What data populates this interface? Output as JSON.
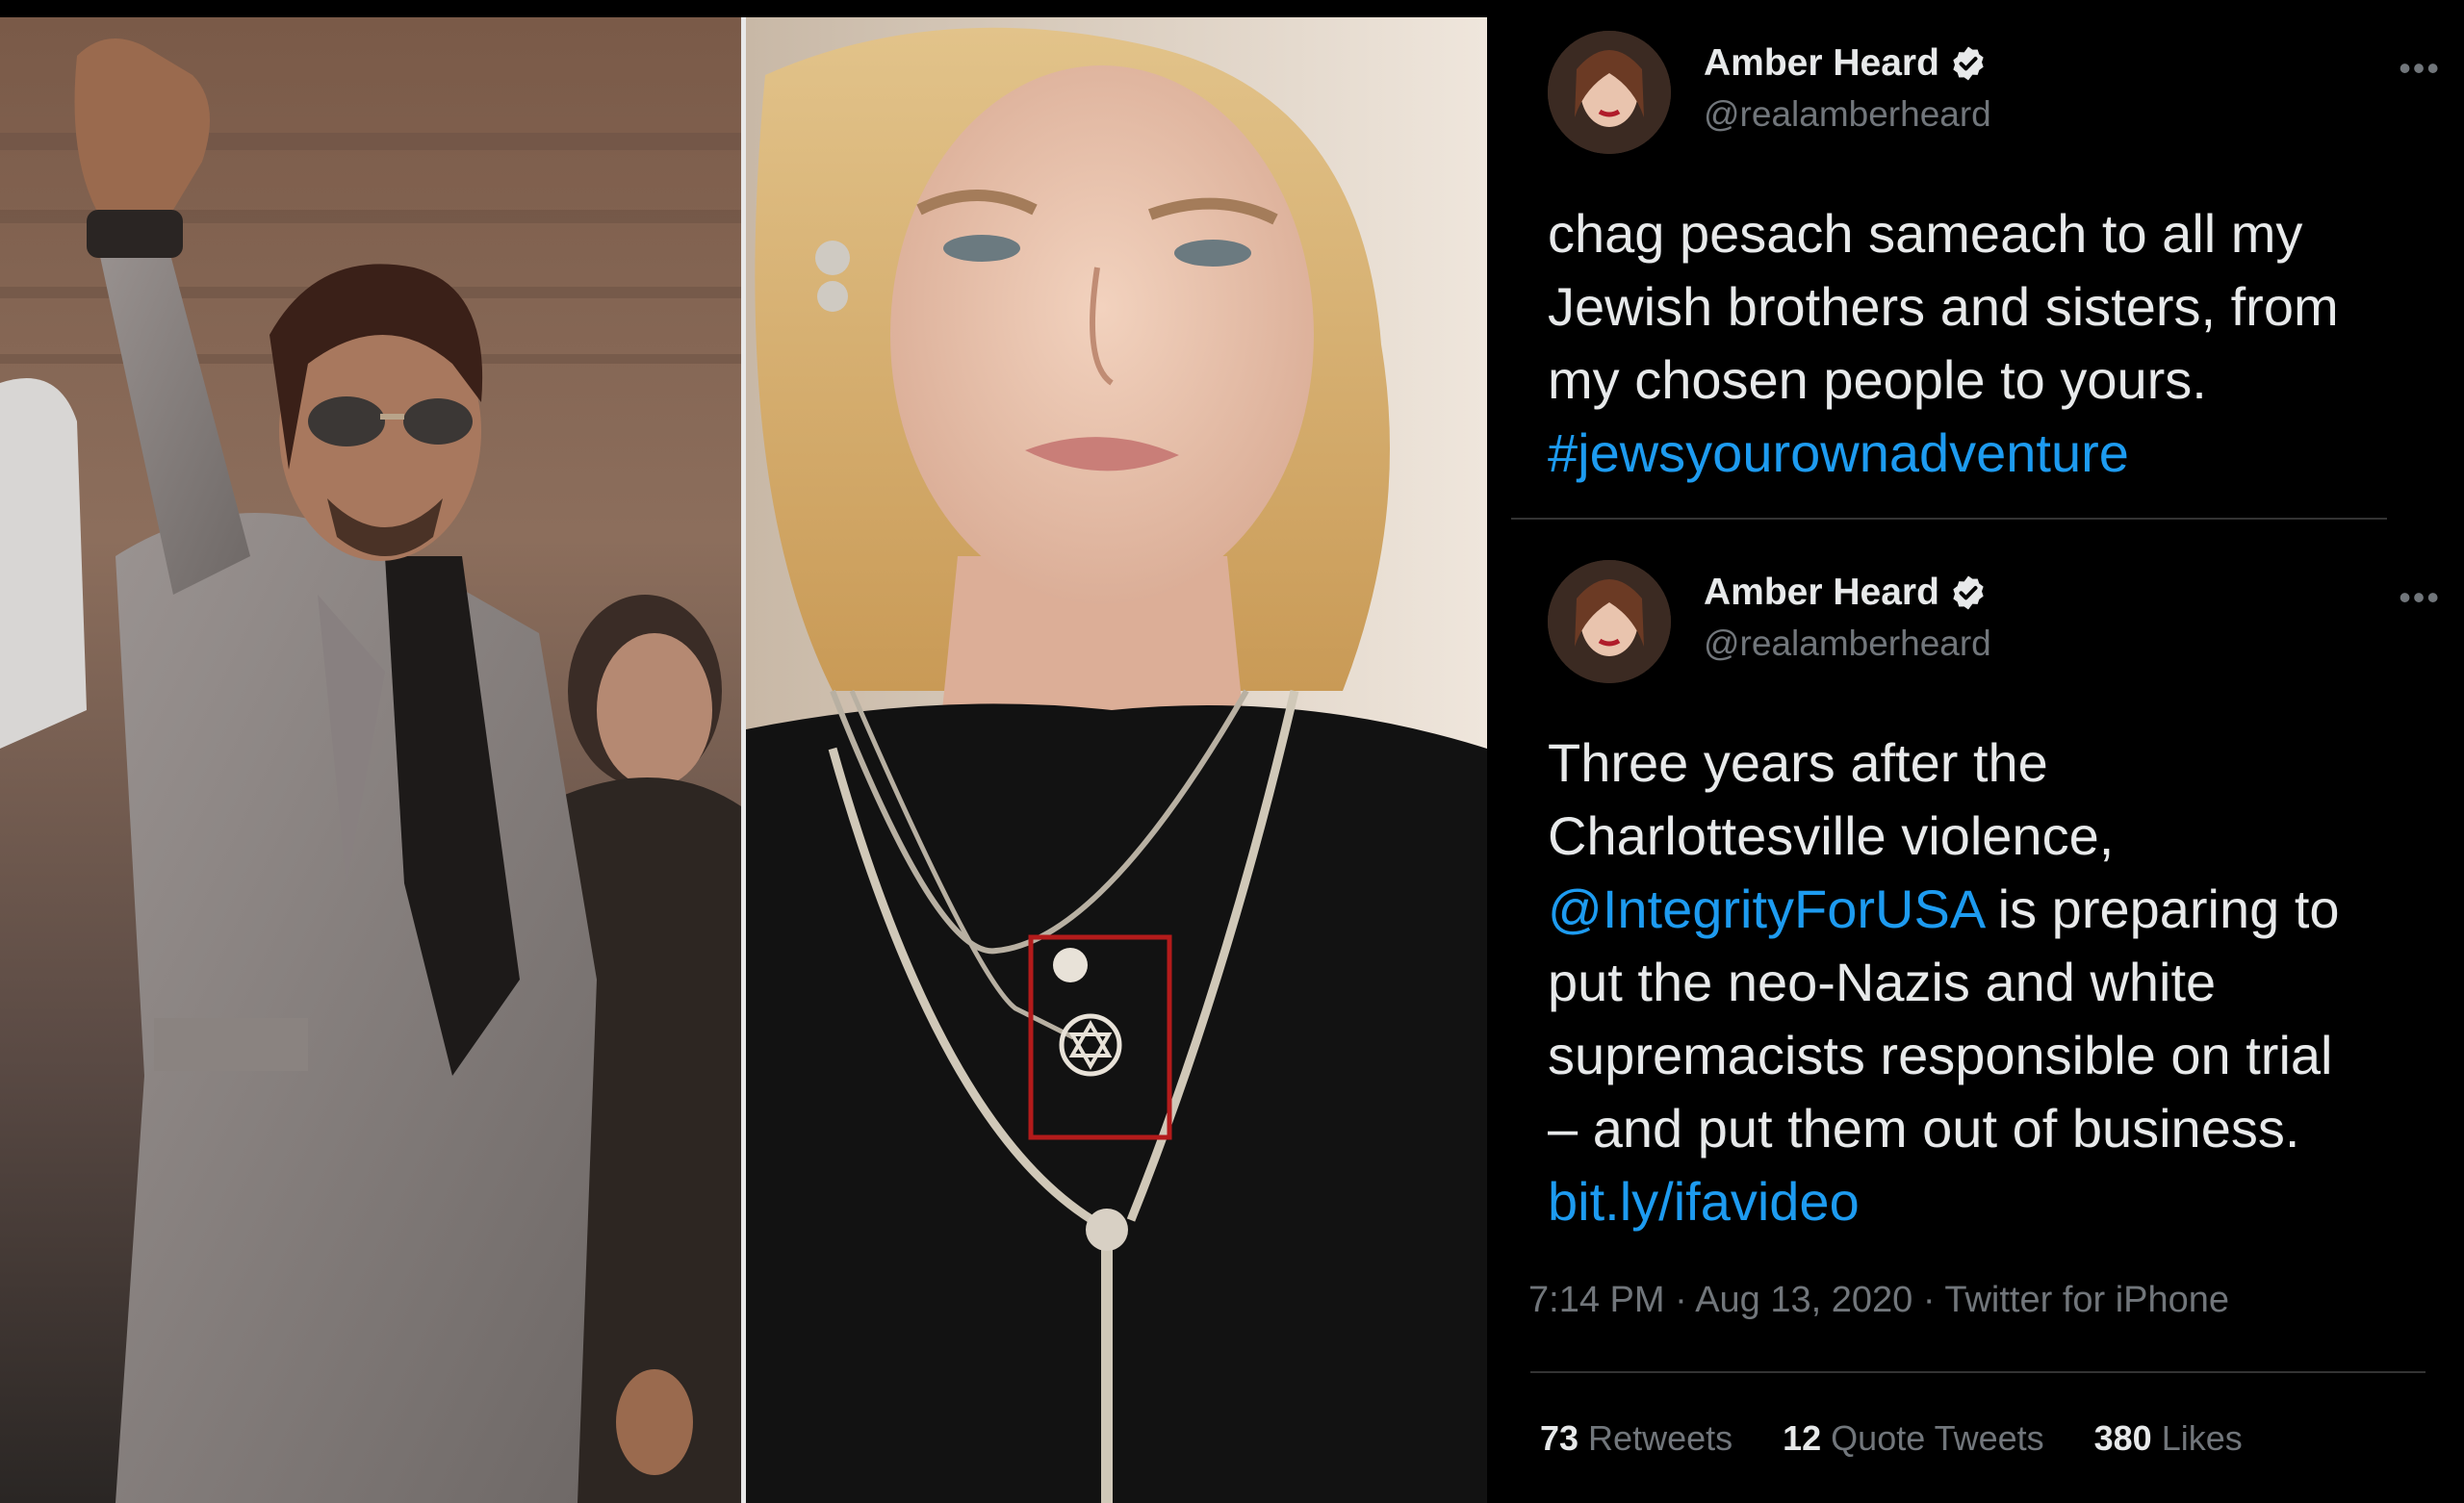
{
  "tweets": [
    {
      "author": {
        "name": "Amber Heard",
        "handle": "@realamberheard",
        "verified": true
      },
      "more_label": "•••",
      "lines": [
        "chag pesach sameach to all my",
        "Jewish brothers and sisters, from",
        "my chosen people to yours."
      ],
      "hashtag": "#jewsyourownadventure"
    },
    {
      "author": {
        "name": "Amber Heard",
        "handle": "@realamberheard",
        "verified": true
      },
      "more_label": "•••",
      "line1": "Three years after the",
      "line2": "Charlottesville violence,",
      "mention": "@IntegrityForUSA",
      "line3_rest": " is preparing to",
      "line4": "put the neo-Nazis and white",
      "line5": "supremacists responsible on trial",
      "line6": "– and put them out of business.",
      "link": "bit.ly/ifavideo",
      "meta": "7:14 PM · Aug 13, 2020 · Twitter for iPhone",
      "stats": {
        "retweets": {
          "count": "73",
          "label": "Retweets"
        },
        "quotes": {
          "count": "12",
          "label": "Quote Tweets"
        },
        "likes": {
          "count": "380",
          "label": "Likes"
        }
      }
    }
  ],
  "colors": {
    "background": "#000000",
    "text": "#e7e9ea",
    "secondary": "#71767b",
    "link": "#1d9bf0",
    "highlight_box": "#b31b1b"
  },
  "icons": [
    "verified-badge-icon",
    "more-options-icon"
  ]
}
